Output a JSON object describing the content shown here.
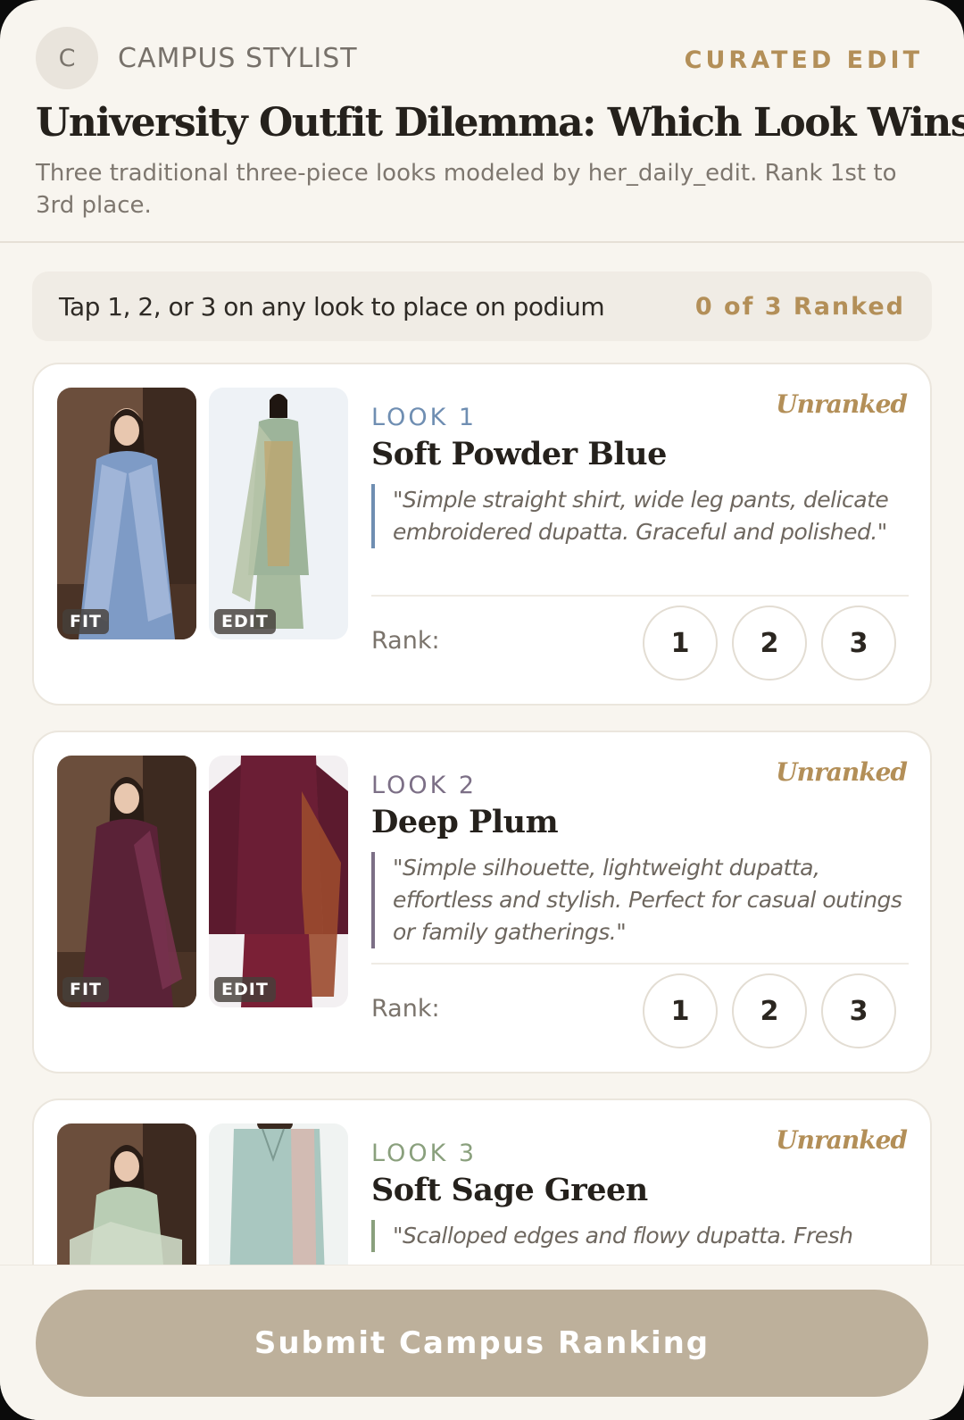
{
  "header": {
    "avatar_letter": "C",
    "brand": "CAMPUS STYLIST",
    "badge": "CURATED EDIT",
    "title": "University Outfit Dilemma: Which Look Wins?",
    "subtitle": "Three traditional three-piece looks modeled by her_daily_edit. Rank 1st to 3rd place."
  },
  "instruction": {
    "text": "Tap 1, 2, or 3 on any look to place on podium",
    "count": "0 of 3 Ranked"
  },
  "tags": {
    "fit": "FIT",
    "edit": "EDIT"
  },
  "rank_label": "Rank:",
  "rank_options": [
    "1",
    "2",
    "3"
  ],
  "looks": [
    {
      "number": "LOOK 1",
      "name": "Soft Powder Blue",
      "status": "Unranked",
      "quote": "\"Simple straight shirt, wide leg pants, delicate embroidered dupatta. Graceful and polished.\"",
      "accent": "#6f8eb2",
      "garment_color": "#7e9bc6",
      "edit_color": "#9db49a"
    },
    {
      "number": "LOOK 2",
      "name": "Deep Plum",
      "status": "Unranked",
      "quote": "\"Simple silhouette, lightweight dupatta, effortless and stylish. Perfect for casual outings or family gatherings.\"",
      "accent": "#7c6f86",
      "garment_color": "#5a2237",
      "edit_color": "#6b1e35"
    },
    {
      "number": "LOOK 3",
      "name": "Soft Sage Green",
      "status": "Unranked",
      "quote": "\"Scalloped edges and flowy dupatta. Fresh",
      "accent": "#8aa07d",
      "garment_color": "#b9cdb4",
      "edit_color": "#a9c7c0"
    }
  ],
  "submit_label": "Submit Campus Ranking"
}
